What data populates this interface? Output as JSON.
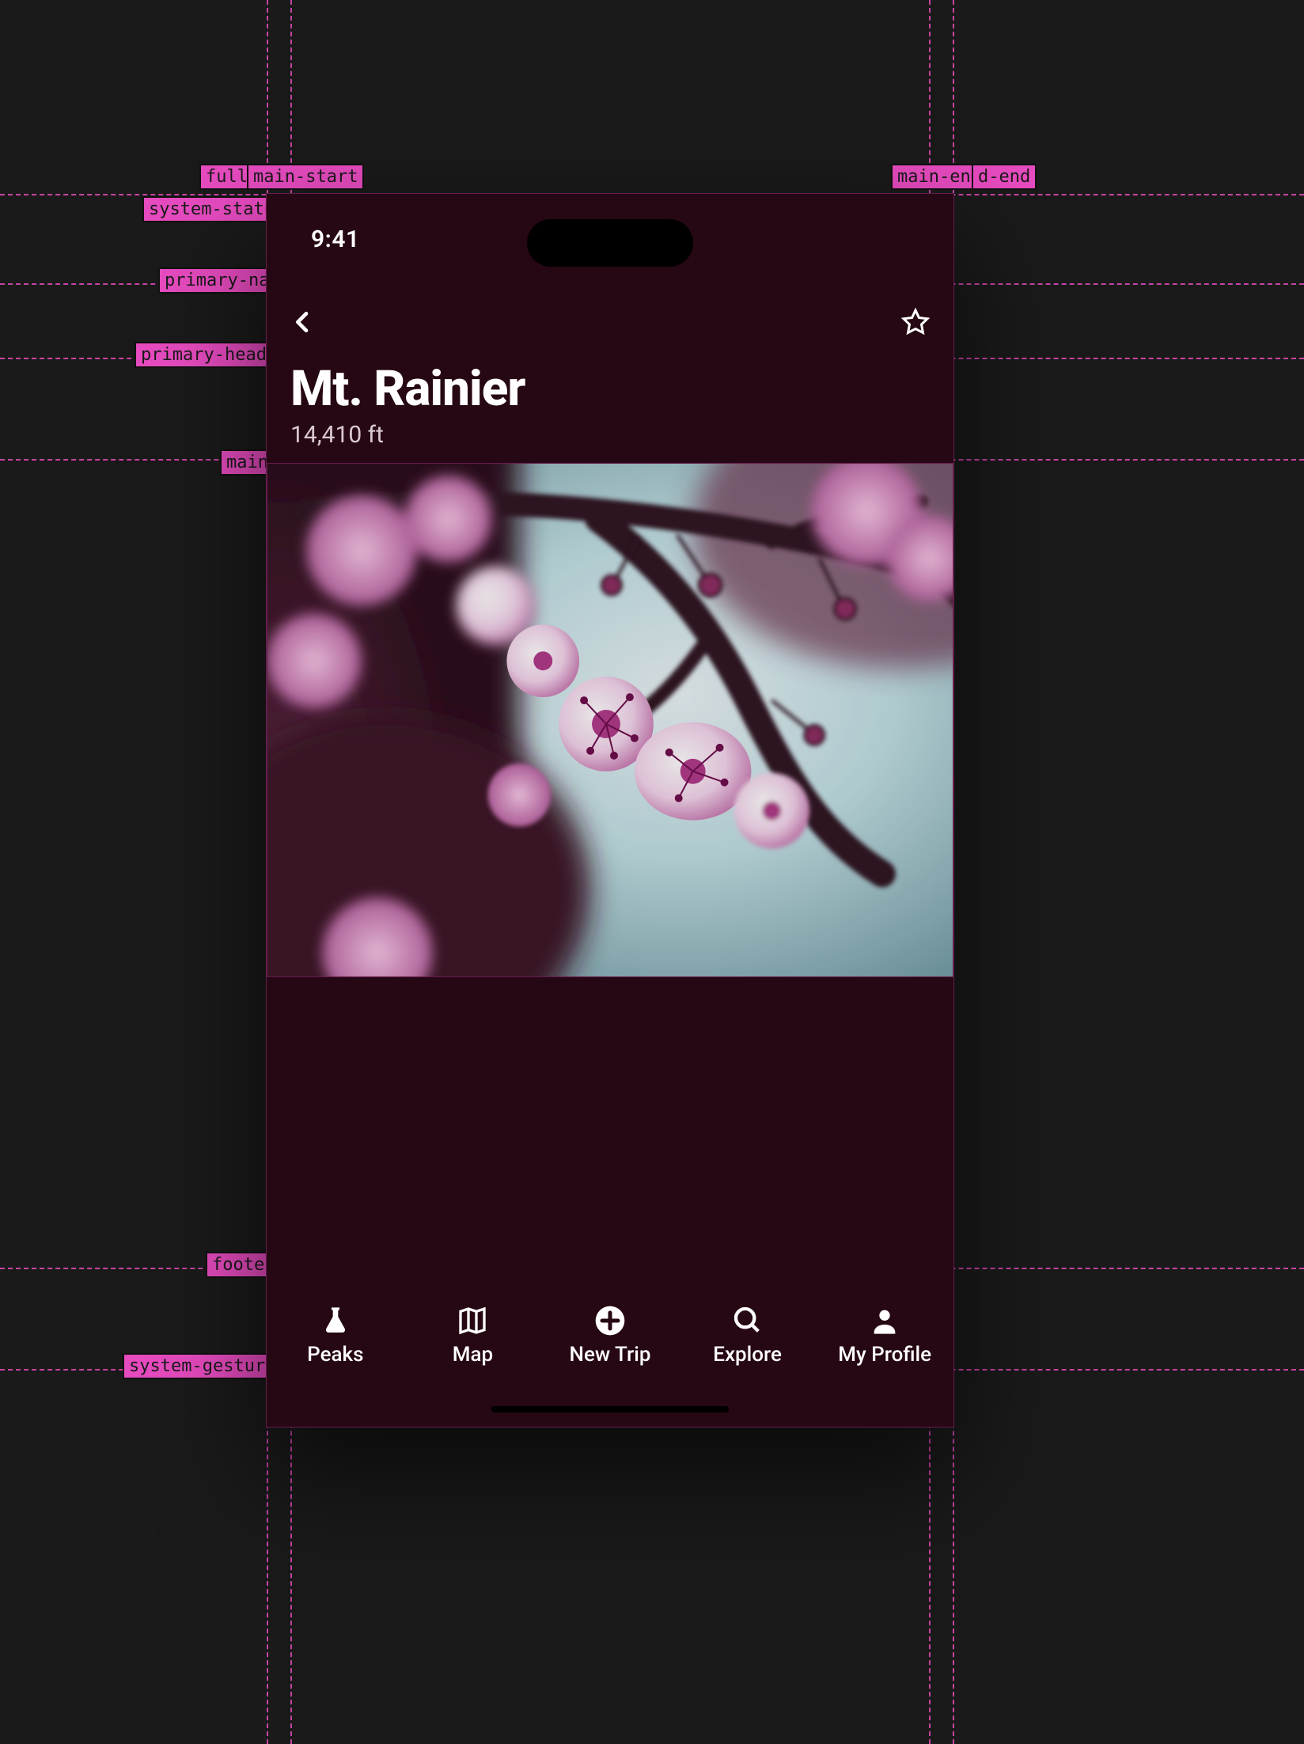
{
  "status": {
    "time": "9:41"
  },
  "header": {
    "title": "Mt. Rainier",
    "subtitle": "14,410 ft"
  },
  "tabs": [
    {
      "label": "Peaks"
    },
    {
      "label": "Map"
    },
    {
      "label": "New Trip"
    },
    {
      "label": "Explore"
    },
    {
      "label": "My Profile"
    }
  ],
  "guides_h": [
    {
      "label": "system-status",
      "label_side": "left"
    },
    {
      "label": "primary-nav",
      "label_side": "left"
    },
    {
      "label": "primary-header",
      "label_side": "left"
    },
    {
      "label": "main",
      "label_side": "left"
    },
    {
      "label": "footer",
      "label_side": "left"
    },
    {
      "label": "system-gestures",
      "label_side": "left"
    }
  ],
  "guides_v": [
    {
      "label": "fullbleed-start"
    },
    {
      "label": "main-start"
    },
    {
      "label": "main-end"
    },
    {
      "label": "fullbleed-end"
    }
  ]
}
